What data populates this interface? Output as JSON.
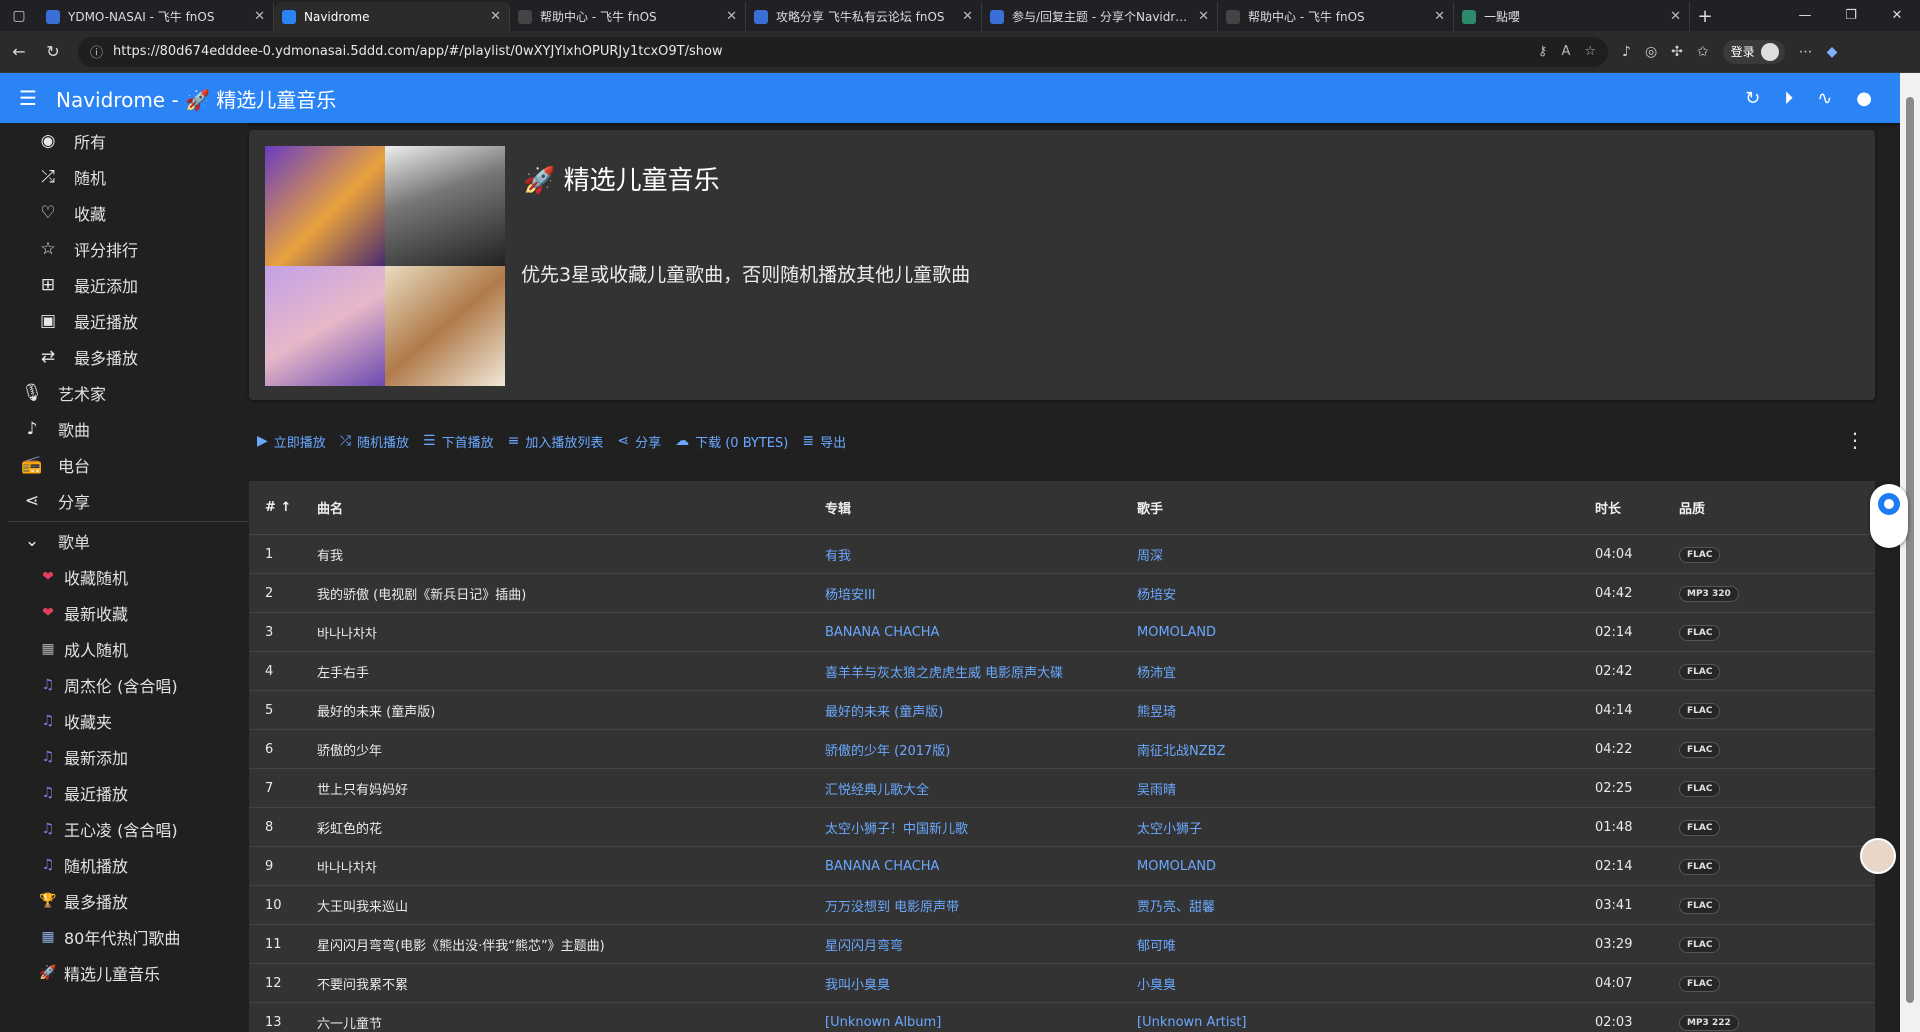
{
  "browser": {
    "tabs": [
      {
        "label": "YDMO-NASAI - 飞牛 fnOS",
        "color": "#3b6fd8",
        "active": false
      },
      {
        "label": "Navidrome",
        "color": "#2b84f5",
        "active": true
      },
      {
        "label": "帮助中心 - 飞牛 fnOS",
        "color": "#444",
        "active": false
      },
      {
        "label": "攻略分享 飞牛私有云论坛 fnOS",
        "color": "#3b6fd8",
        "active": false
      },
      {
        "label": "参与/回复主题 - 分享个Navidrome",
        "color": "#3b6fd8",
        "active": false
      },
      {
        "label": "帮助中心 - 飞牛 fnOS",
        "color": "#444",
        "active": false
      },
      {
        "label": "一點嚶",
        "color": "#2d8a6a",
        "active": false
      }
    ],
    "url": "https://80d674edddee-0.ydmonasai.5ddd.com/app/#/playlist/0wXYJYlxhOPURJy1tcxO9T/show",
    "login_label": "登录"
  },
  "app": {
    "title": "Navidrome - 🚀 精选儿童音乐"
  },
  "sidebar": {
    "items": [
      {
        "label": "所有",
        "icon": "album-icon",
        "glyph": "◉",
        "indent": true
      },
      {
        "label": "随机",
        "icon": "shuffle-icon",
        "glyph": "⤮",
        "indent": true
      },
      {
        "label": "收藏",
        "icon": "heart-icon",
        "glyph": "♡",
        "indent": true
      },
      {
        "label": "评分排行",
        "icon": "star-icon",
        "glyph": "☆",
        "indent": true
      },
      {
        "label": "最近添加",
        "icon": "library-add-icon",
        "glyph": "⊞",
        "indent": true
      },
      {
        "label": "最近播放",
        "icon": "video-library-icon",
        "glyph": "▣",
        "indent": true
      },
      {
        "label": "最多播放",
        "icon": "repeat-icon",
        "glyph": "⇄",
        "indent": true
      },
      {
        "label": "艺术家",
        "icon": "mic-icon",
        "glyph": "🎙",
        "indent": false
      },
      {
        "label": "歌曲",
        "icon": "music-note-icon",
        "glyph": "♪",
        "indent": false
      },
      {
        "label": "电台",
        "icon": "radio-icon",
        "glyph": "📻",
        "indent": false
      },
      {
        "label": "分享",
        "icon": "share-icon",
        "glyph": "⋖",
        "indent": false
      }
    ],
    "playlists_header": "歌单",
    "playlists": [
      {
        "label": "收藏随机",
        "glyph": "❤",
        "color": "#e0405a"
      },
      {
        "label": "最新收藏",
        "glyph": "❤",
        "color": "#e0405a"
      },
      {
        "label": "成人随机",
        "glyph": "▦",
        "color": "#b0b0b0"
      },
      {
        "label": "周杰伦 (含合唱)",
        "glyph": "♫",
        "color": "#8a7be0"
      },
      {
        "label": "收藏夹",
        "glyph": "♫",
        "color": "#8a7be0"
      },
      {
        "label": "最新添加",
        "glyph": "♫",
        "color": "#8a7be0"
      },
      {
        "label": "最近播放",
        "glyph": "♫",
        "color": "#8a7be0"
      },
      {
        "label": "王心凌 (含合唱)",
        "glyph": "♫",
        "color": "#8a7be0"
      },
      {
        "label": "随机播放",
        "glyph": "♫",
        "color": "#8a7be0"
      },
      {
        "label": "最多播放",
        "glyph": "🏆",
        "color": "#e0b040"
      },
      {
        "label": "80年代热门歌曲",
        "glyph": "▦",
        "color": "#8ab0e0"
      },
      {
        "label": "精选儿童音乐",
        "glyph": "🚀",
        "color": "#e06060"
      }
    ]
  },
  "playlist": {
    "title": "🚀 精选儿童音乐",
    "description": "优先3星或收藏儿童歌曲，否则随机播放其他儿童歌曲"
  },
  "toolbar": {
    "actions": [
      {
        "label": "立即播放",
        "icon": "play-icon",
        "glyph": "▶"
      },
      {
        "label": "随机播放",
        "icon": "shuffle-icon",
        "glyph": "⤮"
      },
      {
        "label": "下首播放",
        "icon": "play-next-icon",
        "glyph": "☰"
      },
      {
        "label": "加入播放列表",
        "icon": "playlist-add-icon",
        "glyph": "≡"
      },
      {
        "label": "分享",
        "icon": "share-icon",
        "glyph": "⋖"
      },
      {
        "label": "下载 (0 BYTES)",
        "icon": "cloud-download-icon",
        "glyph": "☁"
      },
      {
        "label": "导出",
        "icon": "export-icon",
        "glyph": "≣"
      }
    ]
  },
  "table": {
    "headers": {
      "no": "#",
      "name": "曲名",
      "album": "专辑",
      "artist": "歌手",
      "duration": "时长",
      "quality": "品质"
    },
    "rows": [
      {
        "no": "1",
        "name": "有我",
        "album": "有我",
        "artist": "周深",
        "duration": "04:04",
        "quality": "FLAC"
      },
      {
        "no": "2",
        "name": "我的骄傲 (电视剧《新兵日记》插曲)",
        "album": "杨培安III",
        "artist": "杨培安",
        "duration": "04:42",
        "quality": "MP3 320"
      },
      {
        "no": "3",
        "name": "바나나차차",
        "album": "BANANA CHACHA",
        "artist": "MOMOLAND",
        "duration": "02:14",
        "quality": "FLAC"
      },
      {
        "no": "4",
        "name": "左手右手",
        "album": "喜羊羊与灰太狼之虎虎生威 电影原声大碟",
        "artist": "杨沛宜",
        "duration": "02:42",
        "quality": "FLAC"
      },
      {
        "no": "5",
        "name": "最好的未来 (童声版)",
        "album": "最好的未来 (童声版)",
        "artist": "熊昱琦",
        "duration": "04:14",
        "quality": "FLAC"
      },
      {
        "no": "6",
        "name": "骄傲的少年",
        "album": "骄傲的少年 (2017版)",
        "artist": "南征北战NZBZ",
        "duration": "04:22",
        "quality": "FLAC"
      },
      {
        "no": "7",
        "name": "世上只有妈妈好",
        "album": "汇悦经典儿歌大全",
        "artist": "吴雨晴",
        "duration": "02:25",
        "quality": "FLAC"
      },
      {
        "no": "8",
        "name": "彩虹色的花",
        "album": "太空小狮子！中国新儿歌",
        "artist": "太空小狮子",
        "duration": "01:48",
        "quality": "FLAC"
      },
      {
        "no": "9",
        "name": "바나나차차",
        "album": "BANANA CHACHA",
        "artist": "MOMOLAND",
        "duration": "02:14",
        "quality": "FLAC"
      },
      {
        "no": "10",
        "name": "大王叫我来巡山",
        "album": "万万没想到 电影原声带",
        "artist": "贾乃亮、甜馨",
        "duration": "03:41",
        "quality": "FLAC"
      },
      {
        "no": "11",
        "name": "星闪闪月弯弯(电影《熊出没·伴我“熊芯”》主题曲)",
        "album": "星闪闪月弯弯",
        "artist": "郁可唯",
        "duration": "03:29",
        "quality": "FLAC"
      },
      {
        "no": "12",
        "name": "不要问我累不累",
        "album": "我叫小臭臭",
        "artist": "小臭臭",
        "duration": "04:07",
        "quality": "FLAC"
      },
      {
        "no": "13",
        "name": "六一儿童节",
        "album": "[Unknown Album]",
        "artist": "[Unknown Artist]",
        "duration": "02:03",
        "quality": "MP3 222"
      }
    ]
  },
  "colors": {
    "accent": "#2b84f5",
    "link": "#6aa8ff",
    "card": "#333333",
    "background": "#202020"
  }
}
